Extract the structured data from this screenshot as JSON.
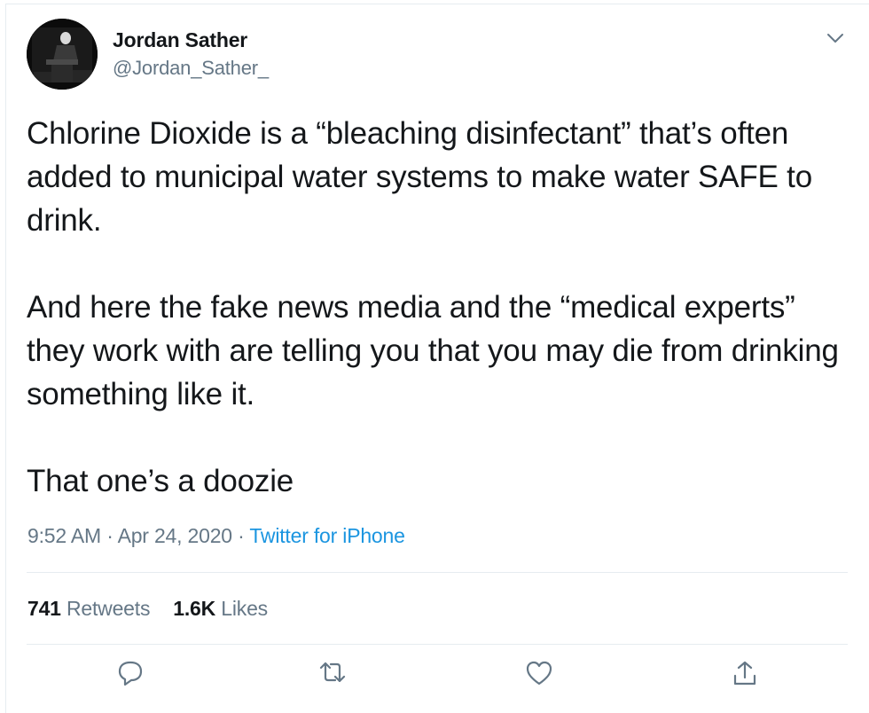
{
  "tweet": {
    "author": {
      "display_name": "Jordan Sather",
      "handle": "@Jordan_Sather_"
    },
    "paragraphs": [
      "Chlorine Dioxide is a “bleaching disinfectant” that’s often added to municipal water systems to make water SAFE to drink.",
      "And here the fake news media and the “medical experts” they work with are telling you that you may die from drinking something like it.",
      "That one’s a doozie"
    ],
    "time": "9:52 AM",
    "separator": " · ",
    "date": "Apr 24, 2020",
    "source": "Twitter for iPhone",
    "stats": {
      "retweets_count": "741",
      "retweets_label": "Retweets",
      "likes_count": "1.6K",
      "likes_label": "Likes"
    },
    "icons": {
      "menu": "chevron-down-icon",
      "reply": "reply-icon",
      "retweet": "retweet-icon",
      "like": "like-icon",
      "share": "share-icon"
    }
  },
  "colors": {
    "text": "#14171a",
    "secondary": "#657786",
    "link": "#1b95e0",
    "border": "#e6ecf0"
  }
}
